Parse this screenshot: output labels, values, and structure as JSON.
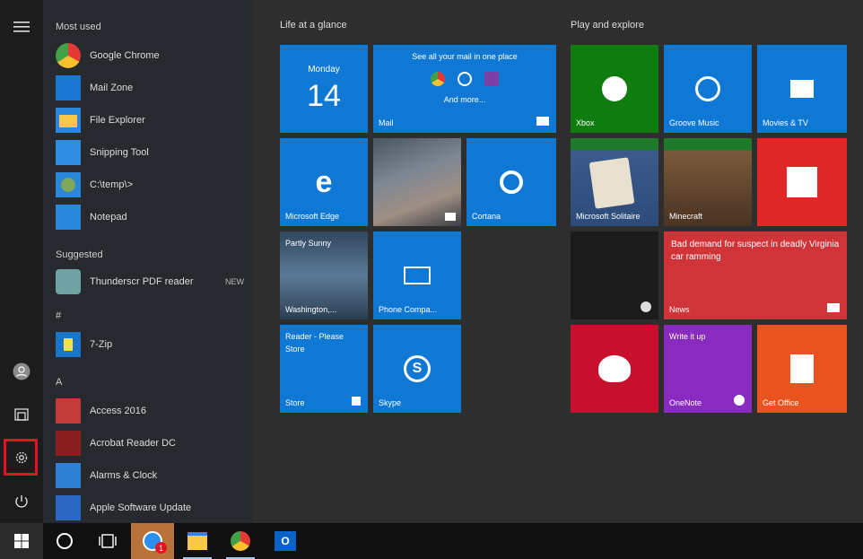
{
  "rail": {
    "icons": [
      "hamburger-icon",
      "user-icon",
      "documents-icon",
      "gear-icon",
      "power-icon"
    ]
  },
  "apps": {
    "most_used_label": "Most used",
    "most_used": [
      {
        "label": "Google Chrome",
        "color": "#e53935"
      },
      {
        "label": "Mail Zone",
        "color": "#1976d2"
      },
      {
        "label": "File Explorer",
        "color": "#f9c84a"
      },
      {
        "label": "Snipping Tool",
        "color": "#2f8de0"
      },
      {
        "label": "C:\\temp\\>",
        "color": "#7fa85c"
      },
      {
        "label": "Notepad",
        "color": "#2a86d8"
      }
    ],
    "suggested_label": "Suggested",
    "suggested": {
      "label": "Thunderscr PDF reader",
      "extra": "NEW",
      "color": "#6fa3a3"
    },
    "letter_hash": "#",
    "hash_app": {
      "label": "7-Zip",
      "color": "#1a74c9"
    },
    "letter_a": "A",
    "a_apps": [
      {
        "label": "Access 2016",
        "color": "#c23a3a"
      },
      {
        "label": "Acrobat Reader DC",
        "color": "#b32a2a"
      },
      {
        "label": "Alarms & Clock",
        "color": "#2f7fd3"
      },
      {
        "label": "Apple Software Update",
        "color": "#2a68c2"
      }
    ]
  },
  "tiles": {
    "group1": "Life at a glance",
    "group2": "Play and explore",
    "calendar": {
      "day": "Monday",
      "date": "14"
    },
    "mail": {
      "headline": "See all your mail in one place",
      "sub": "And more...",
      "label": "Mail"
    },
    "edge": {
      "label": "Microsoft Edge"
    },
    "photos": {
      "label": ""
    },
    "cortana": {
      "label": "Cortana"
    },
    "weather": {
      "title": "Partly Sunny",
      "location": "Washington,..."
    },
    "phone": {
      "label": "Phone Compa..."
    },
    "reader": {
      "line1": "Reader - Please",
      "line2": "Store",
      "label": "Store"
    },
    "skype": {
      "label": "Skype"
    },
    "xbox": {
      "label": "Xbox"
    },
    "groove": {
      "label": "Groove Music"
    },
    "movies": {
      "label": "Movies & TV"
    },
    "solitaire": {
      "label": "Microsoft Solitaire"
    },
    "minecraft": {
      "label": "Minecraft"
    },
    "flipboard": {
      "label": ""
    },
    "news": {
      "label": ""
    },
    "news2": {
      "text": "Bad demand for suspect in deadly Virginia car ramming",
      "label": "News"
    },
    "iheart": {
      "label": ""
    },
    "onenote": {
      "line1": "Write it up",
      "label": "OneNote"
    },
    "office": {
      "label": "Get Office"
    }
  },
  "taskbar": {
    "items": [
      "windows-logo-icon",
      "cortana-circle-icon",
      "task-view-icon",
      "chat-app-icon",
      "file-explorer-icon",
      "chrome-icon",
      "outlook-icon"
    ],
    "badge": "1"
  }
}
